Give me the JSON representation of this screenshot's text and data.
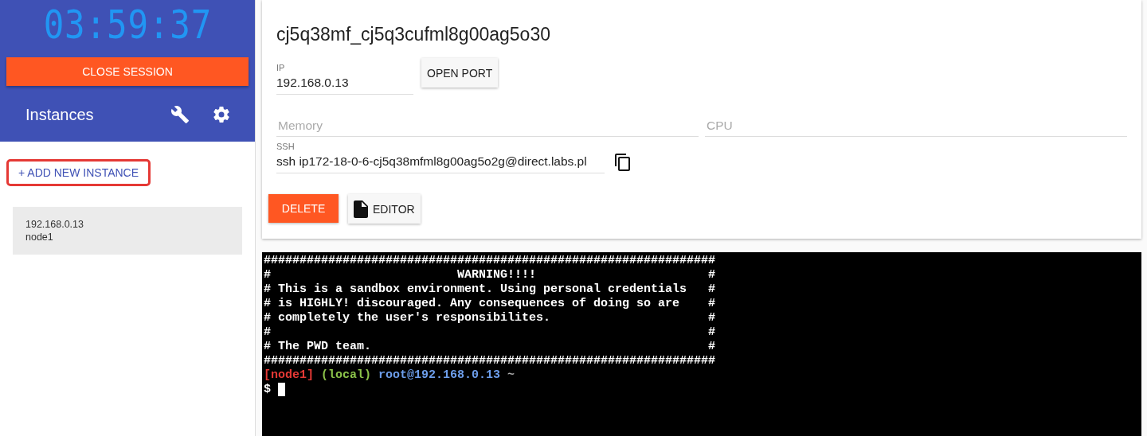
{
  "session": {
    "timer": "03:59:37",
    "close_button": "CLOSE SESSION"
  },
  "sidebar": {
    "title": "Instances",
    "add_button": "+ ADD NEW INSTANCE",
    "instances": [
      {
        "ip": "192.168.0.13",
        "name": "node1",
        "selected": true
      }
    ]
  },
  "instance": {
    "title": "cj5q38mf_cj5q3cufml8g00ag5o30",
    "ip": {
      "label": "IP",
      "value": "192.168.0.13"
    },
    "open_port_button": "OPEN PORT",
    "memory": {
      "placeholder": "Memory"
    },
    "cpu": {
      "placeholder": "CPU"
    },
    "ssh": {
      "label": "SSH",
      "value": "ssh ip172-18-0-6-cj5q38mfml8g00ag5o2g@direct.labs.pl"
    },
    "delete_button": "DELETE",
    "editor_button": "EDITOR"
  },
  "terminal": {
    "lines": [
      "###############################################################",
      "#                          WARNING!!!!                        #",
      "# This is a sandbox environment. Using personal credentials   #",
      "# is HIGHLY! discouraged. Any consequences of doing so are    #",
      "# completely the user's responsibilites.                      #",
      "#                                                             #",
      "# The PWD team.                                               #",
      "###############################################################"
    ],
    "prompt": {
      "node": "[node1]",
      "env": "(local)",
      "host": "root@192.168.0.13",
      "path": "~"
    },
    "input_prefix": "$"
  }
}
